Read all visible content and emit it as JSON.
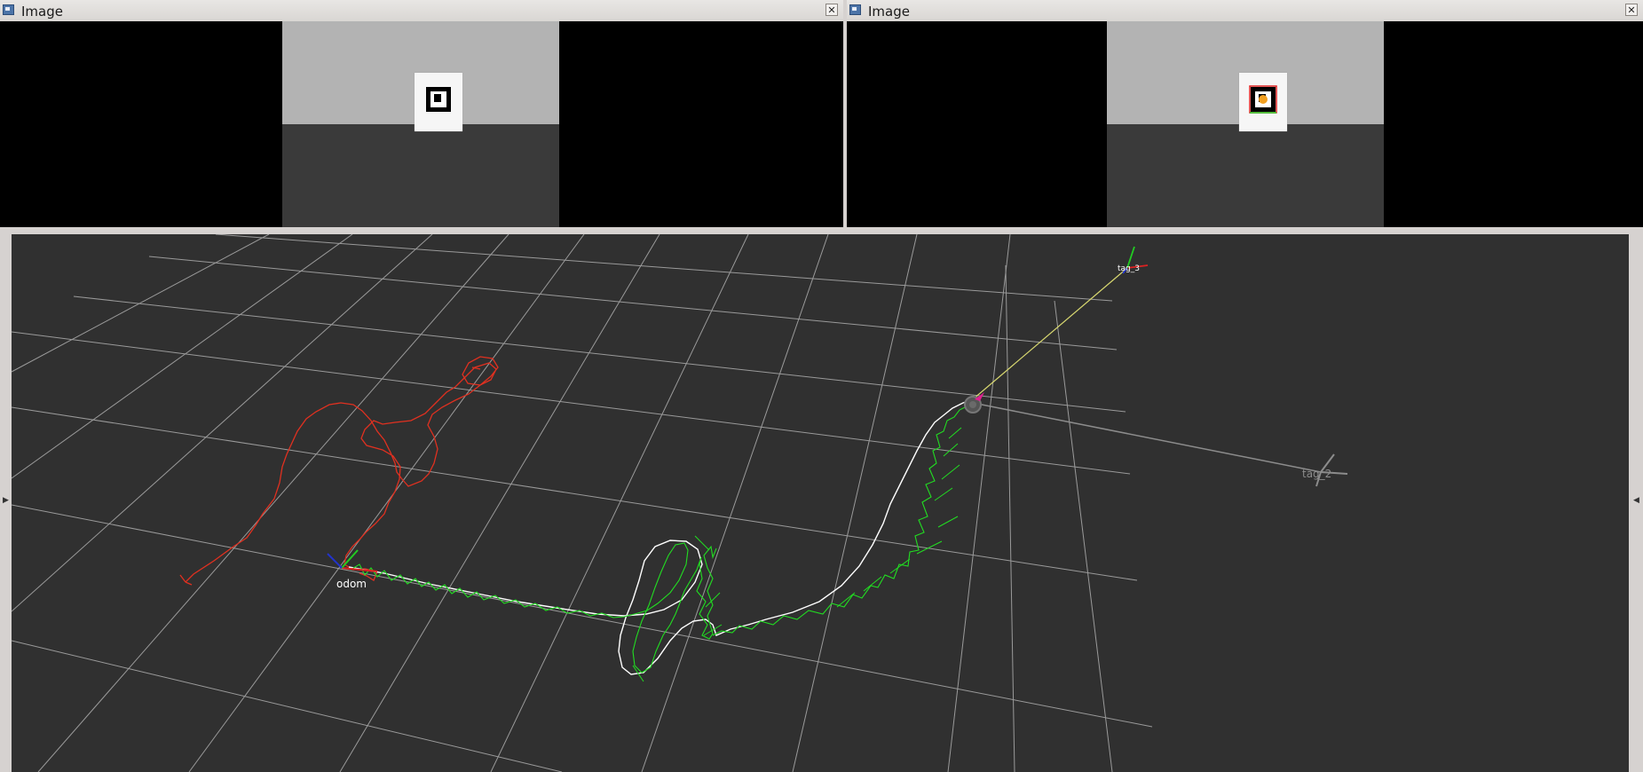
{
  "image_windows": [
    {
      "title": "Image",
      "close_label": "✕"
    },
    {
      "title": "Image",
      "close_label": "✕"
    }
  ],
  "viewport": {
    "frames": {
      "odom": "odom",
      "tag_3": "tag_3",
      "tag_2": "tag_2"
    },
    "colors": {
      "background": "#303030",
      "grid": "#a0a0a0",
      "raw_odometry_path": "#e03020",
      "filtered_path": "#ffffff",
      "noisy_path": "#22dd22",
      "tag_ray": "#d8d870"
    }
  },
  "side_handles": {
    "left_arrow": "▶",
    "right_arrow": "◀"
  }
}
